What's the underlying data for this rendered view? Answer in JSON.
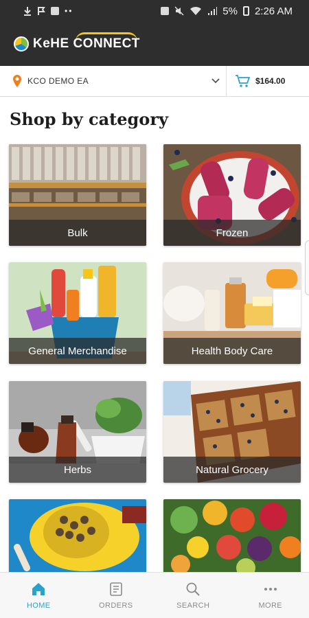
{
  "status_bar": {
    "battery": "5%",
    "time": "2:26 AM",
    "left_icons": [
      "download-icon",
      "flag-icon",
      "image-icon",
      "more-dots-icon"
    ],
    "right_icons": [
      "sim-icon",
      "mute-icon",
      "wifi-icon",
      "signal-icon",
      "battery-icon"
    ]
  },
  "header": {
    "logo_text": "KeHE CONNECT",
    "brand_colors": {
      "green": "#7ac143",
      "blue": "#1e88c8",
      "yellow": "#f5c518"
    }
  },
  "toolbar": {
    "location": "KCO DEMO EA",
    "location_icon": "pin-icon",
    "location_color": "#f07f1f",
    "cart_icon": "cart-icon",
    "cart_color": "#29a3c9",
    "cart_total": "$164.00"
  },
  "main": {
    "title": "Shop by category",
    "categories": [
      {
        "label": "Bulk",
        "image": "bulk-bins-image"
      },
      {
        "label": "Frozen",
        "image": "frozen-popsicles-image"
      },
      {
        "label": "General Merchandise",
        "image": "cleaning-supplies-image"
      },
      {
        "label": "Health Body Care",
        "image": "body-care-image"
      },
      {
        "label": "Herbs",
        "image": "herbs-mortar-image"
      },
      {
        "label": "Natural Grocery",
        "image": "granola-bars-image"
      },
      {
        "label": "",
        "image": "pet-food-image"
      },
      {
        "label": "",
        "image": "produce-image"
      }
    ]
  },
  "bottom_nav": {
    "active_color": "#29a3c9",
    "items": [
      {
        "label": "HOME",
        "icon": "home-icon",
        "active": true
      },
      {
        "label": "ORDERS",
        "icon": "orders-icon",
        "active": false
      },
      {
        "label": "SEARCH",
        "icon": "search-icon",
        "active": false
      },
      {
        "label": "MORE",
        "icon": "more-icon",
        "active": false
      }
    ]
  }
}
